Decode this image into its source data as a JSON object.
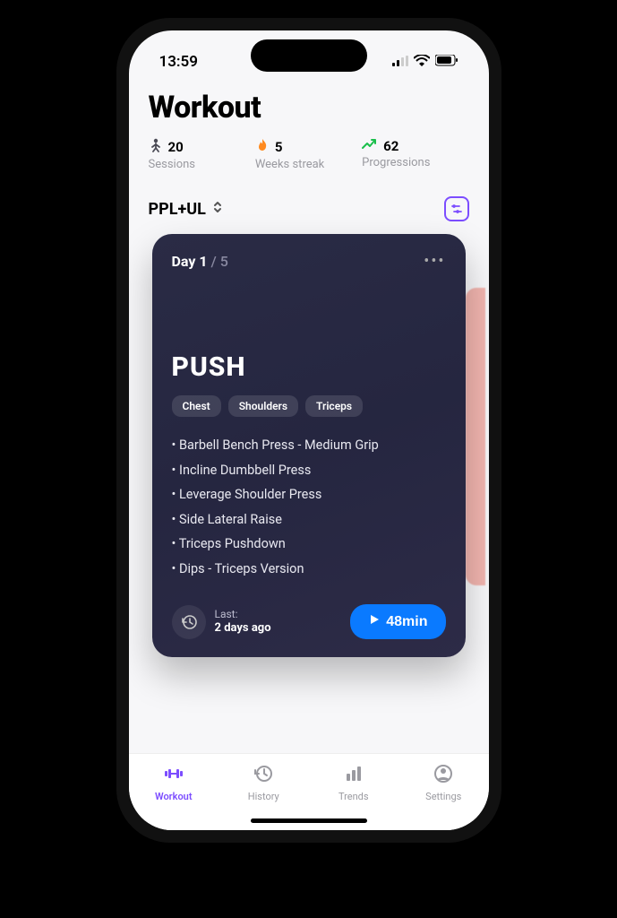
{
  "status": {
    "time": "13:59"
  },
  "page_title": "Workout",
  "stats": {
    "sessions": {
      "value": "20",
      "label": "Sessions"
    },
    "streak": {
      "value": "5",
      "label": "Weeks streak"
    },
    "progress": {
      "value": "62",
      "label": "Progressions"
    }
  },
  "plan": {
    "name": "PPL+UL"
  },
  "card": {
    "day_current": "Day 1",
    "day_total": "/ 5",
    "title": "PUSH",
    "tags": [
      "Chest",
      "Shoulders",
      "Triceps"
    ],
    "exercises": [
      "Barbell Bench Press - Medium Grip",
      "Incline Dumbbell Press",
      "Leverage Shoulder Press",
      "Side Lateral Raise",
      "Triceps Pushdown",
      "Dips - Triceps Version"
    ],
    "last_label": "Last:",
    "last_value": "2 days ago",
    "duration": "48min"
  },
  "tabs": {
    "workout": "Workout",
    "history": "History",
    "trends": "Trends",
    "settings": "Settings"
  }
}
